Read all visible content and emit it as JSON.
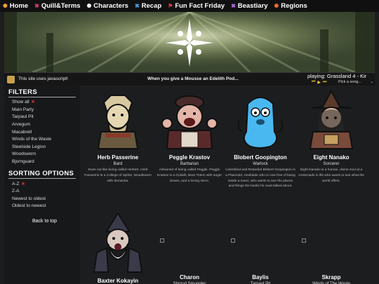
{
  "nav": [
    {
      "label": "Home",
      "icon": "home-icon",
      "color": "#f0a030"
    },
    {
      "label": "Quill&Terms",
      "icon": "quill-icon",
      "color": "#e03a6a"
    },
    {
      "label": "Characters",
      "icon": "people-icon",
      "color": "#ffffff"
    },
    {
      "label": "Recap",
      "icon": "book-icon",
      "color": "#4aa0e0"
    },
    {
      "label": "Fun Fact Friday",
      "icon": "flag-icon",
      "color": "#e03a4a"
    },
    {
      "label": "Beastiary",
      "icon": "paw-icon",
      "color": "#b06ae0"
    },
    {
      "label": "Regions",
      "icon": "compass-icon",
      "color": "#f06a30"
    }
  ],
  "jsbar": {
    "notice": "This site uses javascript!",
    "podcast": "When you give a Mousse an Edelith Pod...",
    "playing": "playing: Grassland 4 - Kir",
    "select": "Pick a song..."
  },
  "filters": {
    "heading": "FILTERS",
    "items": [
      "Show all",
      "Main Party",
      "Tarpaul Pit",
      "Arvegum",
      "Macabrell",
      "Winds of the Waste",
      "Steelside Legion",
      "Woodsworn",
      "Bjornguard"
    ]
  },
  "sorting": {
    "heading": "SORTING OPTIONS",
    "items": [
      "A-Z",
      "Z-A",
      "Newest to oldest",
      "Oldest to newest"
    ]
  },
  "back_to_top": "Back to top",
  "characters": [
    {
      "name": "Herb Passerine",
      "class": "Bard",
      "desc": "Does not like being called Herbert. Herb Passerine is a College of Spirits, Woodsworn with dementia."
    },
    {
      "name": "Peggle Krastov",
      "class": "Barbarian",
      "desc": "Ashamed of being called Peggle. Peggle Krastov is a Goliath, Bear Totem with anger issues, and a loving niece."
    },
    {
      "name": "Blobert Goopington",
      "class": "Warlock",
      "desc": "Colorblind and Retarded Blobert Goopington is a Plasmoid, Hexblade who is now free of being inside a tower, who wants to see the places and things the books he read talked about."
    },
    {
      "name": "Eight Nanako",
      "class": "Sorcerer",
      "desc": "Eight Nanako is a human, divine soul at a crossroads in life who wants to see what the world offers."
    },
    {
      "name": "Baxter Kokayin",
      "class": "Wizard",
      "desc": ""
    },
    {
      "name": "Charon",
      "class": "Shroud Smuggler",
      "desc": ""
    },
    {
      "name": "Baylis",
      "class": "Tarpaul Pit",
      "desc": ""
    },
    {
      "name": "Skrapp",
      "class": "Winds of The Waste",
      "desc": ""
    }
  ]
}
